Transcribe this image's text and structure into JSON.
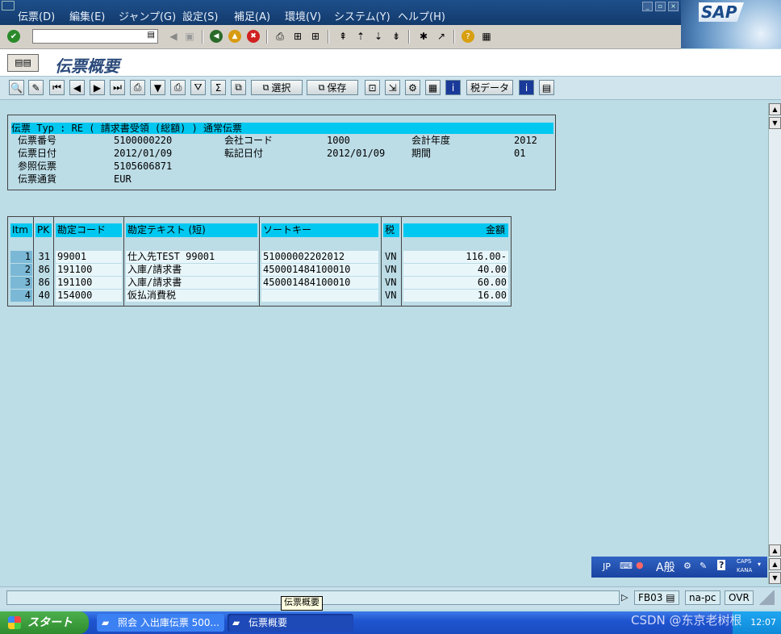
{
  "menu": [
    "伝票(D)",
    "編集(E)",
    "ジャンプ(G)",
    "設定(S)",
    "補足(A)",
    "環境(V)",
    "システム(Y)",
    "ヘルプ(H)"
  ],
  "sap_logo": "SAP",
  "command_field": {
    "value": ""
  },
  "title": "伝票概要",
  "app_toolbar": {
    "select_label": "選択",
    "save_label": "保存",
    "tax_data_label": "税データ"
  },
  "header": {
    "title_line": "伝票 Typ : RE ( 請求書受領 (総額) ) 通常伝票",
    "doc_no_label": "伝票番号",
    "doc_no": "5100000220",
    "company_code_label": "会社コード",
    "company_code": "1000",
    "fiscal_year_label": "会計年度",
    "fiscal_year": "2012",
    "doc_date_label": "伝票日付",
    "doc_date": "2012/01/09",
    "posting_date_label": "転記日付",
    "posting_date": "2012/01/09",
    "period_label": "期間",
    "period": "01",
    "reference_label": "参照伝票",
    "reference": "5105606871",
    "currency_label": "伝票通貨",
    "currency": "EUR"
  },
  "table": {
    "headers": {
      "itm": "Itm",
      "pk": "PK",
      "account": "勘定コード",
      "text": "勘定テキスト (短)",
      "sort_key": "ソートキー",
      "tax": "税",
      "amount": "金額"
    },
    "rows": [
      {
        "itm": "1",
        "pk": "31",
        "account": "99001",
        "text": "仕入先TEST 99001",
        "sort_key": "51000002202012",
        "tax": "VN",
        "amount": "116.00-"
      },
      {
        "itm": "2",
        "pk": "86",
        "account": "191100",
        "text": "入庫/請求書",
        "sort_key": "450001484100010",
        "tax": "VN",
        "amount": "40.00"
      },
      {
        "itm": "3",
        "pk": "86",
        "account": "191100",
        "text": "入庫/請求書",
        "sort_key": "450001484100010",
        "tax": "VN",
        "amount": "60.00"
      },
      {
        "itm": "4",
        "pk": "40",
        "account": "154000",
        "text": "仮払消費税",
        "sort_key": "",
        "tax": "VN",
        "amount": "16.00"
      }
    ]
  },
  "ime": {
    "lang": "JP",
    "mode": "A般",
    "caps": "CAPS",
    "kana": "KANA"
  },
  "status": {
    "transaction": "FB03",
    "server": "na-pc",
    "mode": "OVR"
  },
  "tooltip": "伝票概要",
  "taskbar": {
    "start": "スタート",
    "tasks": [
      "照会 入出庫伝票 500...",
      "伝票概要"
    ],
    "clock": "12:07"
  },
  "watermark": "CSDN @东京老树根",
  "colors": {
    "menu_bg": "#1e4f8a",
    "highlight": "#00c8f0",
    "screen_bg": "#bcdce6"
  }
}
